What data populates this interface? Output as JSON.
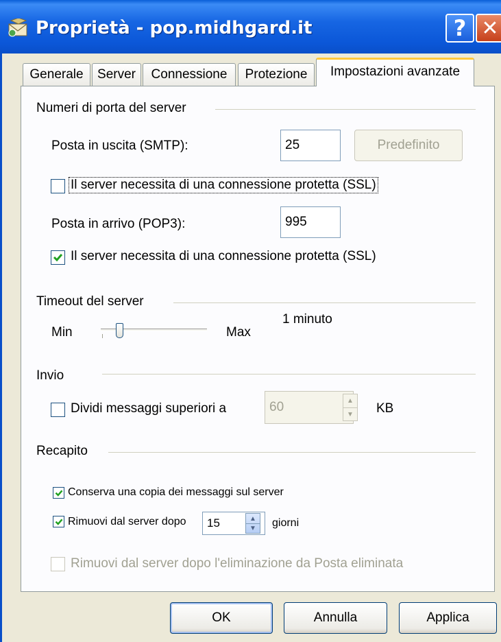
{
  "window": {
    "title": "Proprietà - pop.midhgard.it",
    "help_glyph": "?",
    "close_glyph": "✕"
  },
  "tabs": [
    {
      "label": "Generale",
      "active": false
    },
    {
      "label": "Server",
      "active": false
    },
    {
      "label": "Connessione",
      "active": false
    },
    {
      "label": "Protezione",
      "active": false
    },
    {
      "label": "Impostazioni avanzate",
      "active": true
    }
  ],
  "ports": {
    "group_title": "Numeri di porta del server",
    "smtp_label": "Posta in uscita (SMTP):",
    "smtp_value": "25",
    "default_button": "Predefinito",
    "smtp_ssl_label": "Il server necessita di una connessione protetta (SSL)",
    "smtp_ssl_checked": false,
    "pop3_label": "Posta in arrivo (POP3):",
    "pop3_value": "995",
    "pop3_ssl_label": "Il server necessita di una connessione protetta (SSL)",
    "pop3_ssl_checked": true
  },
  "timeout": {
    "group_title": "Timeout del server",
    "min_label": "Min",
    "max_label": "Max",
    "value_text": "1 minuto",
    "slider_fraction": 0.14
  },
  "sending": {
    "group_title": "Invio",
    "split_label": "Dividi messaggi superiori a",
    "split_checked": false,
    "split_value": "60",
    "split_unit": "KB"
  },
  "delivery": {
    "group_title": "Recapito",
    "keep_copy_label": "Conserva una copia dei messaggi sul server",
    "keep_copy_checked": true,
    "remove_after_label": "Rimuovi dal server dopo",
    "remove_after_checked": true,
    "remove_after_value": "15",
    "remove_after_unit": "giorni",
    "remove_deleted_label": "Rimuovi dal server dopo l'eliminazione da Posta eliminata",
    "remove_deleted_checked": false
  },
  "footer": {
    "ok": "OK",
    "cancel": "Annulla",
    "apply": "Applica"
  },
  "colors": {
    "titlebar": "#0B57D8",
    "dialog_bg": "#ECE9D8",
    "panel_bg": "#FCFCFE",
    "check_green": "#21A121",
    "active_tab_accent": "#FFC83C"
  }
}
